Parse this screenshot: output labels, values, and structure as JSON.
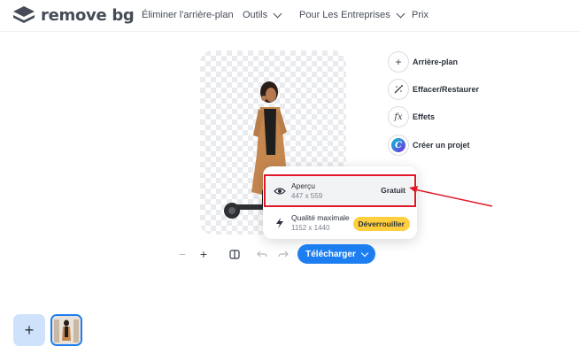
{
  "header": {
    "logo_text_main": "remove",
    "logo_text_accent": "bg",
    "nav": [
      {
        "label": "Éliminer l'arrière-plan"
      },
      {
        "label": "Outils"
      },
      {
        "label": "Pour Les Entreprises"
      },
      {
        "label": "Prix"
      }
    ]
  },
  "tools": [
    {
      "label": "Arrière-plan",
      "icon": "plus-icon"
    },
    {
      "label": "Effacer/Restaurer",
      "icon": "magic-wand-icon"
    },
    {
      "label": "Effets",
      "icon": "fx-icon"
    },
    {
      "label": "Créer un projet",
      "icon": "canva-icon"
    }
  ],
  "download_menu": {
    "options": [
      {
        "title": "Aperçu",
        "size": "447 x 559",
        "badge": "Gratuit",
        "icon": "eye-icon"
      },
      {
        "title": "Qualité maximale",
        "size": "1152 x 1440",
        "badge": "Déverrouiller",
        "icon": "lightning-icon"
      }
    ]
  },
  "toolbar": {
    "zoom_out": "−",
    "zoom_in": "+",
    "download_label": "Télécharger"
  },
  "colors": {
    "accent": "#1d7ef2",
    "highlight": "#e0182a",
    "unlock_badge": "#ffcf3d"
  }
}
